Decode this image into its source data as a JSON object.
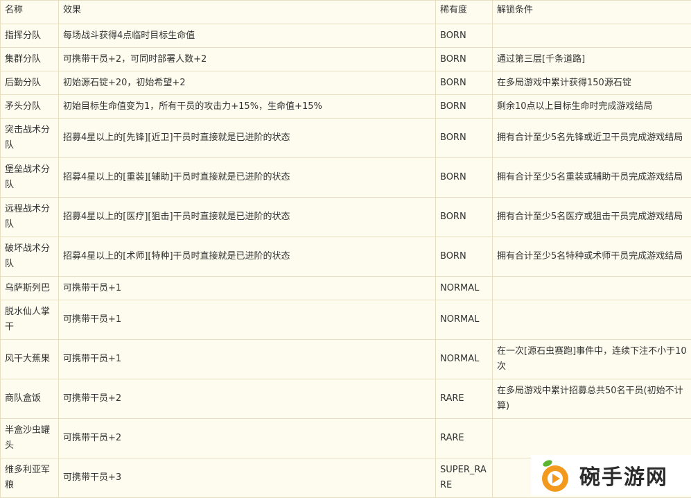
{
  "table": {
    "headers": [
      "名称",
      "效果",
      "稀有度",
      "解锁条件"
    ],
    "rows": [
      {
        "name": "指挥分队",
        "effect": "每场战斗获得4点临时目标生命值",
        "rarity": "BORN",
        "unlock": ""
      },
      {
        "name": "集群分队",
        "effect": "可携带干员+2，可同时部署人数+2",
        "rarity": "BORN",
        "unlock": "通过第三层[千条道路]"
      },
      {
        "name": "后勤分队",
        "effect": "初始源石锭+20，初始希望+2",
        "rarity": "BORN",
        "unlock": "在多局游戏中累计获得150源石锭"
      },
      {
        "name": "矛头分队",
        "effect": "初始目标生命值变为1，所有干员的攻击力+15%，生命值+15%",
        "rarity": "BORN",
        "unlock": "剩余10点以上目标生命时完成游戏结局"
      },
      {
        "name": "突击战术分队",
        "effect": "招募4星以上的[先锋][近卫]干员时直接就是已进阶的状态",
        "rarity": "BORN",
        "unlock": "拥有合计至少5名先锋或近卫干员完成游戏结局"
      },
      {
        "name": "堡垒战术分队",
        "effect": "招募4星以上的[重装][辅助]干员时直接就是已进阶的状态",
        "rarity": "BORN",
        "unlock": "拥有合计至少5名重装或辅助干员完成游戏结局"
      },
      {
        "name": "远程战术分队",
        "effect": "招募4星以上的[医疗][狙击]干员时直接就是已进阶的状态",
        "rarity": "BORN",
        "unlock": "拥有合计至少5名医疗或狙击干员完成游戏结局"
      },
      {
        "name": "破坏战术分队",
        "effect": "招募4星以上的[术师][特种]干员时直接就是已进阶的状态",
        "rarity": "BORN",
        "unlock": "拥有合计至少5名特种或术师干员完成游戏结局"
      },
      {
        "name": "乌萨斯列巴",
        "effect": "可携带干员+1",
        "rarity": "NORMAL",
        "unlock": ""
      },
      {
        "name": "脱水仙人掌干",
        "effect": "可携带干员+1",
        "rarity": "NORMAL",
        "unlock": ""
      },
      {
        "name": "风干大蕉果",
        "effect": "可携带干员+1",
        "rarity": "NORMAL",
        "unlock": "在一次[源石虫赛跑]事件中，连续下注不小于10次"
      },
      {
        "name": "商队盒饭",
        "effect": "可携带干员+2",
        "rarity": "RARE",
        "unlock": "在多局游戏中累计招募总共50名干员(初始不计算)"
      },
      {
        "name": "半盒沙虫罐头",
        "effect": "可携带干员+2",
        "rarity": "RARE",
        "unlock": ""
      },
      {
        "name": "维多利亚军粮",
        "effect": "可携带干员+3",
        "rarity": "SUPER_RARE",
        "unlock": ""
      }
    ]
  },
  "watermark": {
    "text": "碗手游网",
    "colors": {
      "orange": "#f39a1e",
      "green": "#5cb531"
    }
  }
}
